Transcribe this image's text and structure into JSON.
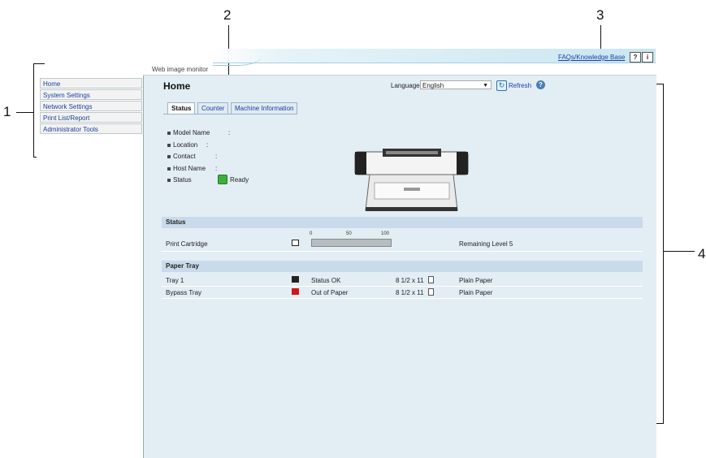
{
  "callouts": [
    "1",
    "2",
    "3",
    "4"
  ],
  "header": {
    "faq_link": "FAQs/Knowledge Base",
    "help_icon": "?",
    "info_icon": "i",
    "app_name": "Web image monitor"
  },
  "sidebar": {
    "items": [
      {
        "label": "Home"
      },
      {
        "label": "System Settings"
      },
      {
        "label": "Network Settings"
      },
      {
        "label": "Print List/Report"
      },
      {
        "label": "Administrator Tools"
      }
    ]
  },
  "main": {
    "title": "Home",
    "language_label": "Language",
    "language_value": "English",
    "refresh_label": "Refresh",
    "help_symbol": "?",
    "tabs": [
      {
        "label": "Status",
        "active": true
      },
      {
        "label": "Counter",
        "active": false
      },
      {
        "label": "Machine Information",
        "active": false
      }
    ],
    "info": [
      {
        "label": "Model Name",
        "value": ""
      },
      {
        "label": "Location",
        "value": ""
      },
      {
        "label": "Contact",
        "value": ""
      },
      {
        "label": "Host Name",
        "value": ""
      },
      {
        "label": "Status",
        "value": "Ready"
      }
    ],
    "status_section": {
      "title": "Status",
      "scale": [
        "0",
        "50",
        "100"
      ],
      "cartridge_label": "Print Cartridge",
      "cartridge_level_fraction": 1.0,
      "cartridge_remaining": "Remaining Level 5"
    },
    "paper_section": {
      "title": "Paper Tray",
      "rows": [
        {
          "tray": "Tray 1",
          "status": "Status OK",
          "size": "8 1/2 x 11",
          "type": "Plain Paper",
          "icon_color": "#222222"
        },
        {
          "tray": "Bypass Tray",
          "status": "Out of Paper",
          "size": "8 1/2 x 11",
          "type": "Plain Paper",
          "icon_color": "#d01818"
        }
      ]
    }
  }
}
